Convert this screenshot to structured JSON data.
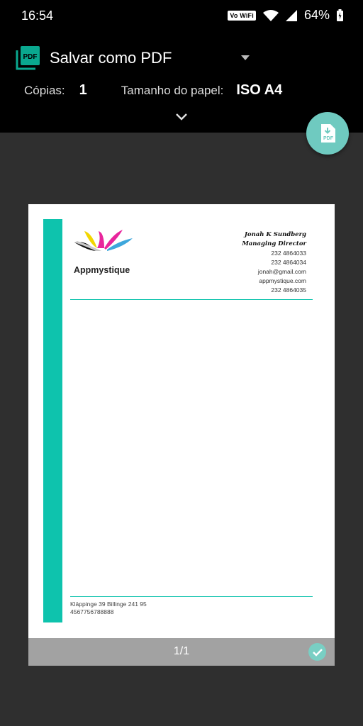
{
  "status_bar": {
    "time": "16:54",
    "volte_badge": "Vo WiFi",
    "battery": "64%"
  },
  "header": {
    "printer_name": "Salvar como PDF",
    "app_icon_text": "PDF",
    "copies_label": "Cópias:",
    "copies_value": "1",
    "paper_size_label": "Tamanho do papel:",
    "paper_size_value": "ISO A4",
    "fab_icon_text": "PDF"
  },
  "document": {
    "company_name": "Appmystique",
    "contact_name": "Jonah K Sundberg",
    "contact_title": "Managing Director",
    "phone_1": "232 4864033",
    "phone_2": "232 4864034",
    "email": "jonah@gmail.com",
    "website": "appmystique.com",
    "phone_3": "232 4864035",
    "address": "Kläppinge 39 Billinge 241 95",
    "footer_number": "4567756788888"
  },
  "preview": {
    "page_indicator": "1/1"
  },
  "colors": {
    "accent_teal": "#0ec3ad",
    "fab": "#6fcac0",
    "background": "#2f2f2f",
    "header_background": "#000000"
  }
}
